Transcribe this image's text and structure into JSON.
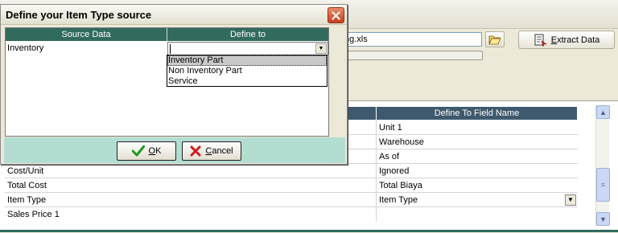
{
  "background": {
    "file_path_fragment": "ng.xls",
    "extract_button": {
      "pre": "",
      "accel": "E",
      "post": "xtract Data"
    },
    "grid": {
      "header_col2": "Define To Field Name",
      "rows": [
        {
          "source": "",
          "target": "Unit 1"
        },
        {
          "source": "",
          "target": "Warehouse"
        },
        {
          "source": "",
          "target": "As of"
        },
        {
          "source": "Cost/Unit",
          "target": "Ignored"
        },
        {
          "source": "Total Cost",
          "target": "Total Biaya"
        },
        {
          "source": "Item Type",
          "target": "Item Type"
        },
        {
          "source": "Sales Price 1",
          "target": ""
        }
      ]
    }
  },
  "dialog": {
    "title": "Define your Item Type source",
    "headers": {
      "source": "Source Data",
      "define": "Define to"
    },
    "row": {
      "source": "Inventory",
      "value": ""
    },
    "dropdown": {
      "options": [
        "Inventory Part",
        "Non Inventory Part",
        "Service"
      ],
      "selected_index": 0
    },
    "ok": {
      "accel": "O",
      "rest": "K"
    },
    "cancel": {
      "accel": "C",
      "rest": "ancel"
    }
  },
  "colors": {
    "dialog_header": "#316b5d",
    "grid_header": "#3f5a6e",
    "button_strip": "#b4ddd2",
    "close_button": "#c6421f"
  }
}
